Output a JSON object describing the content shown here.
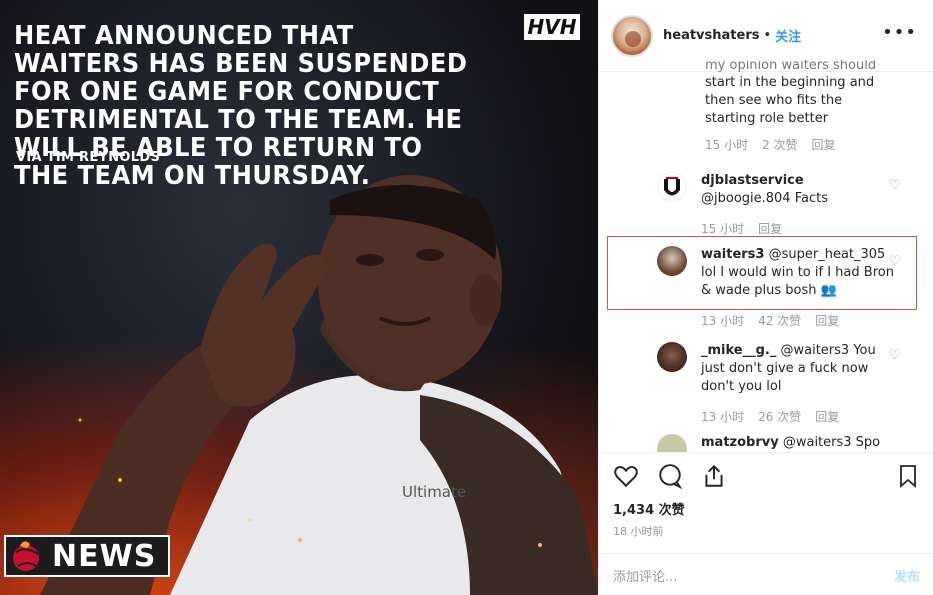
{
  "post_image": {
    "headline": "HEAT ANNOUNCED THAT WAITERS HAS BEEN SUSPENDED FOR ONE GAME FOR CONDUCT DETRIMENTAL TO THE TEAM. HE WILL BE ABLE TO RETURN TO THE TEAM ON THURSDAY.",
    "credit": "VIA TIM REYNOLDS",
    "logo_text": "HVH",
    "badge_text": "NEWS",
    "jersey_text": "Ultimate"
  },
  "header": {
    "username": "heatvshaters",
    "separator": "•",
    "follow_label": "关注",
    "more_icon": "more-horizontal-icon"
  },
  "comments": {
    "partial_top": {
      "text_line0": "my opinion waiters should",
      "text": "start in the beginning and then see who fits the starting role better",
      "time": "15 小时",
      "likes": "2 次赞",
      "reply": "回复"
    },
    "items": [
      {
        "user": "djblastservice",
        "text": "@jboogie.804 Facts",
        "time": "15 小时",
        "reply": "回复"
      },
      {
        "user": "waiters3",
        "text": "@super_heat_305 lol I would win to if I had Bron & wade plus bosh",
        "time": "13 小时",
        "likes": "42 次赞",
        "reply": "回复"
      },
      {
        "user": "_mike__g._",
        "text": "@waiters3 You just don't give a fuck now don't you lol",
        "time": "13 小时",
        "likes": "26 次赞",
        "reply": "回复"
      },
      {
        "user": "matzobrvy",
        "text": "@waiters3 Spo"
      }
    ]
  },
  "actions": {
    "likes": "1,434 次赞",
    "timestamp": "18 小时前",
    "comment_placeholder": "添加评论...",
    "post_label": "发布"
  },
  "colors": {
    "accent": "#3897f0",
    "highlight_border": "#d9534f"
  }
}
